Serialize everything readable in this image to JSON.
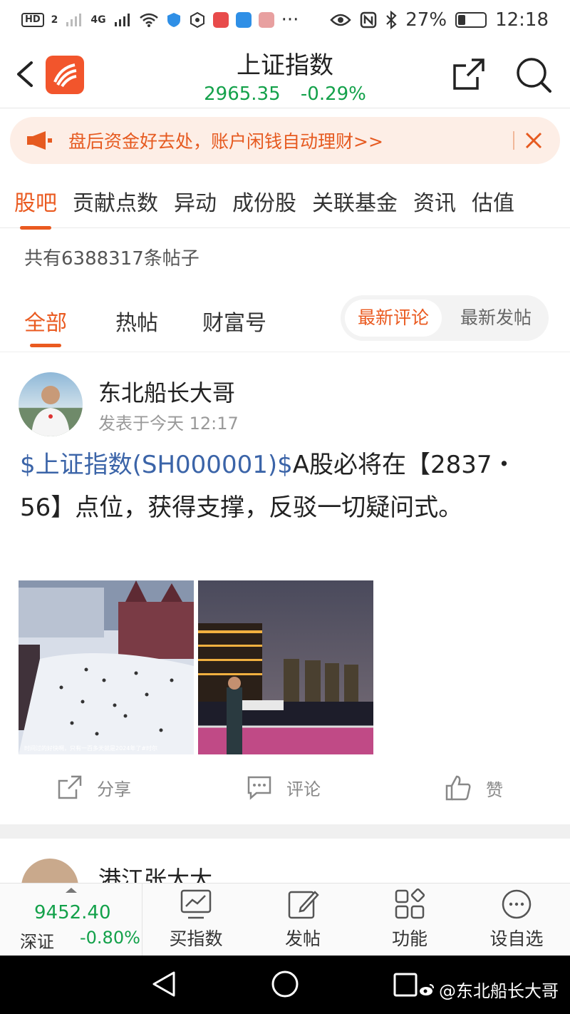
{
  "status_bar": {
    "hd": "HD",
    "sim": "2",
    "network": "4G",
    "battery": "27%",
    "battery_level": 0.27,
    "time": "12:18",
    "more": "···"
  },
  "header": {
    "title": "上证指数",
    "price": "2965.35",
    "change": "-0.29%"
  },
  "banner": {
    "text": "盘后资金好去处，账户闲钱自动理财>>"
  },
  "tabs": [
    {
      "label": "股吧",
      "active": true
    },
    {
      "label": "贡献点数"
    },
    {
      "label": "异动"
    },
    {
      "label": "成份股"
    },
    {
      "label": "关联基金"
    },
    {
      "label": "资讯"
    },
    {
      "label": "估值"
    }
  ],
  "post_count": "共有6388317条帖子",
  "subtabs": {
    "all": "全部",
    "hot": "热帖",
    "wealth": "财富号",
    "sort_latest_comment": "最新评论",
    "sort_latest_post": "最新发帖"
  },
  "post": {
    "author": "东北船长大哥",
    "time": "发表于今天 12:17",
    "stock_link": "$上证指数(SH000001)$",
    "text": "A股必将在【2837・56】点位，获得支撑，反驳一切疑问式。",
    "image_caption": "时间过的好快啊，只有一百多天就是2024年了#时尔",
    "actions": {
      "share": "分享",
      "comment": "评论",
      "like": "赞"
    }
  },
  "next_post": {
    "author": "港江张大大"
  },
  "toolbar": {
    "index_value": "9452.40",
    "index_name": "深证",
    "index_change": "-0.80%",
    "buy_index": "买指数",
    "post": "发帖",
    "functions": "功能",
    "add_watchlist": "设自选"
  },
  "watermark": "@东北船长大哥",
  "colors": {
    "accent": "#ea5a20",
    "down_green": "#13a14a",
    "link_blue": "#3b64a8",
    "banner_bg": "#fdeee6"
  }
}
